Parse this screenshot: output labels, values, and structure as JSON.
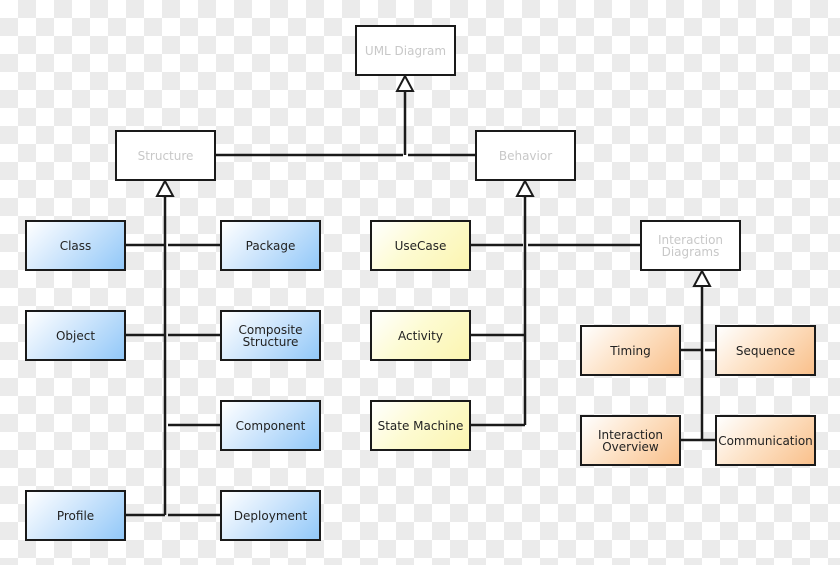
{
  "diagram": {
    "title": "UML Diagram",
    "colors": {
      "structure_fill": "#a8d3fa",
      "behavior_fill": "#fcf8c0",
      "interaction_fill": "#fbcc9e",
      "abstract_text": "#c8c8c8",
      "line": "#1a1a1a"
    },
    "nodes": {
      "uml": "UML Diagram",
      "structure": "Structure",
      "behavior": "Behavior",
      "class": "Class",
      "package": "Package",
      "object": "Object",
      "composite": "Composite\nStructure",
      "component": "Component",
      "profile": "Profile",
      "deployment": "Deployment",
      "usecase": "UseCase",
      "activity": "Activity",
      "statemachine": "State Machine",
      "interaction": "Interaction\nDiagrams",
      "timing": "Timing",
      "sequence": "Sequence",
      "overview": "Interaction\nOverview",
      "communication": "Communication"
    },
    "relations": [
      {
        "from": "Structure",
        "to": "UML Diagram",
        "type": "generalization"
      },
      {
        "from": "Behavior",
        "to": "UML Diagram",
        "type": "generalization"
      },
      {
        "from": "Class",
        "to": "Structure",
        "type": "generalization"
      },
      {
        "from": "Package",
        "to": "Structure",
        "type": "generalization"
      },
      {
        "from": "Object",
        "to": "Structure",
        "type": "generalization"
      },
      {
        "from": "Composite Structure",
        "to": "Structure",
        "type": "generalization"
      },
      {
        "from": "Component",
        "to": "Structure",
        "type": "generalization"
      },
      {
        "from": "Profile",
        "to": "Structure",
        "type": "generalization"
      },
      {
        "from": "Deployment",
        "to": "Structure",
        "type": "generalization"
      },
      {
        "from": "UseCase",
        "to": "Behavior",
        "type": "generalization"
      },
      {
        "from": "Activity",
        "to": "Behavior",
        "type": "generalization"
      },
      {
        "from": "State Machine",
        "to": "Behavior",
        "type": "generalization"
      },
      {
        "from": "Interaction Diagrams",
        "to": "Behavior",
        "type": "generalization"
      },
      {
        "from": "Timing",
        "to": "Interaction Diagrams",
        "type": "generalization"
      },
      {
        "from": "Sequence",
        "to": "Interaction Diagrams",
        "type": "generalization"
      },
      {
        "from": "Interaction Overview",
        "to": "Interaction Diagrams",
        "type": "generalization"
      },
      {
        "from": "Communication",
        "to": "Interaction Diagrams",
        "type": "generalization"
      }
    ]
  }
}
